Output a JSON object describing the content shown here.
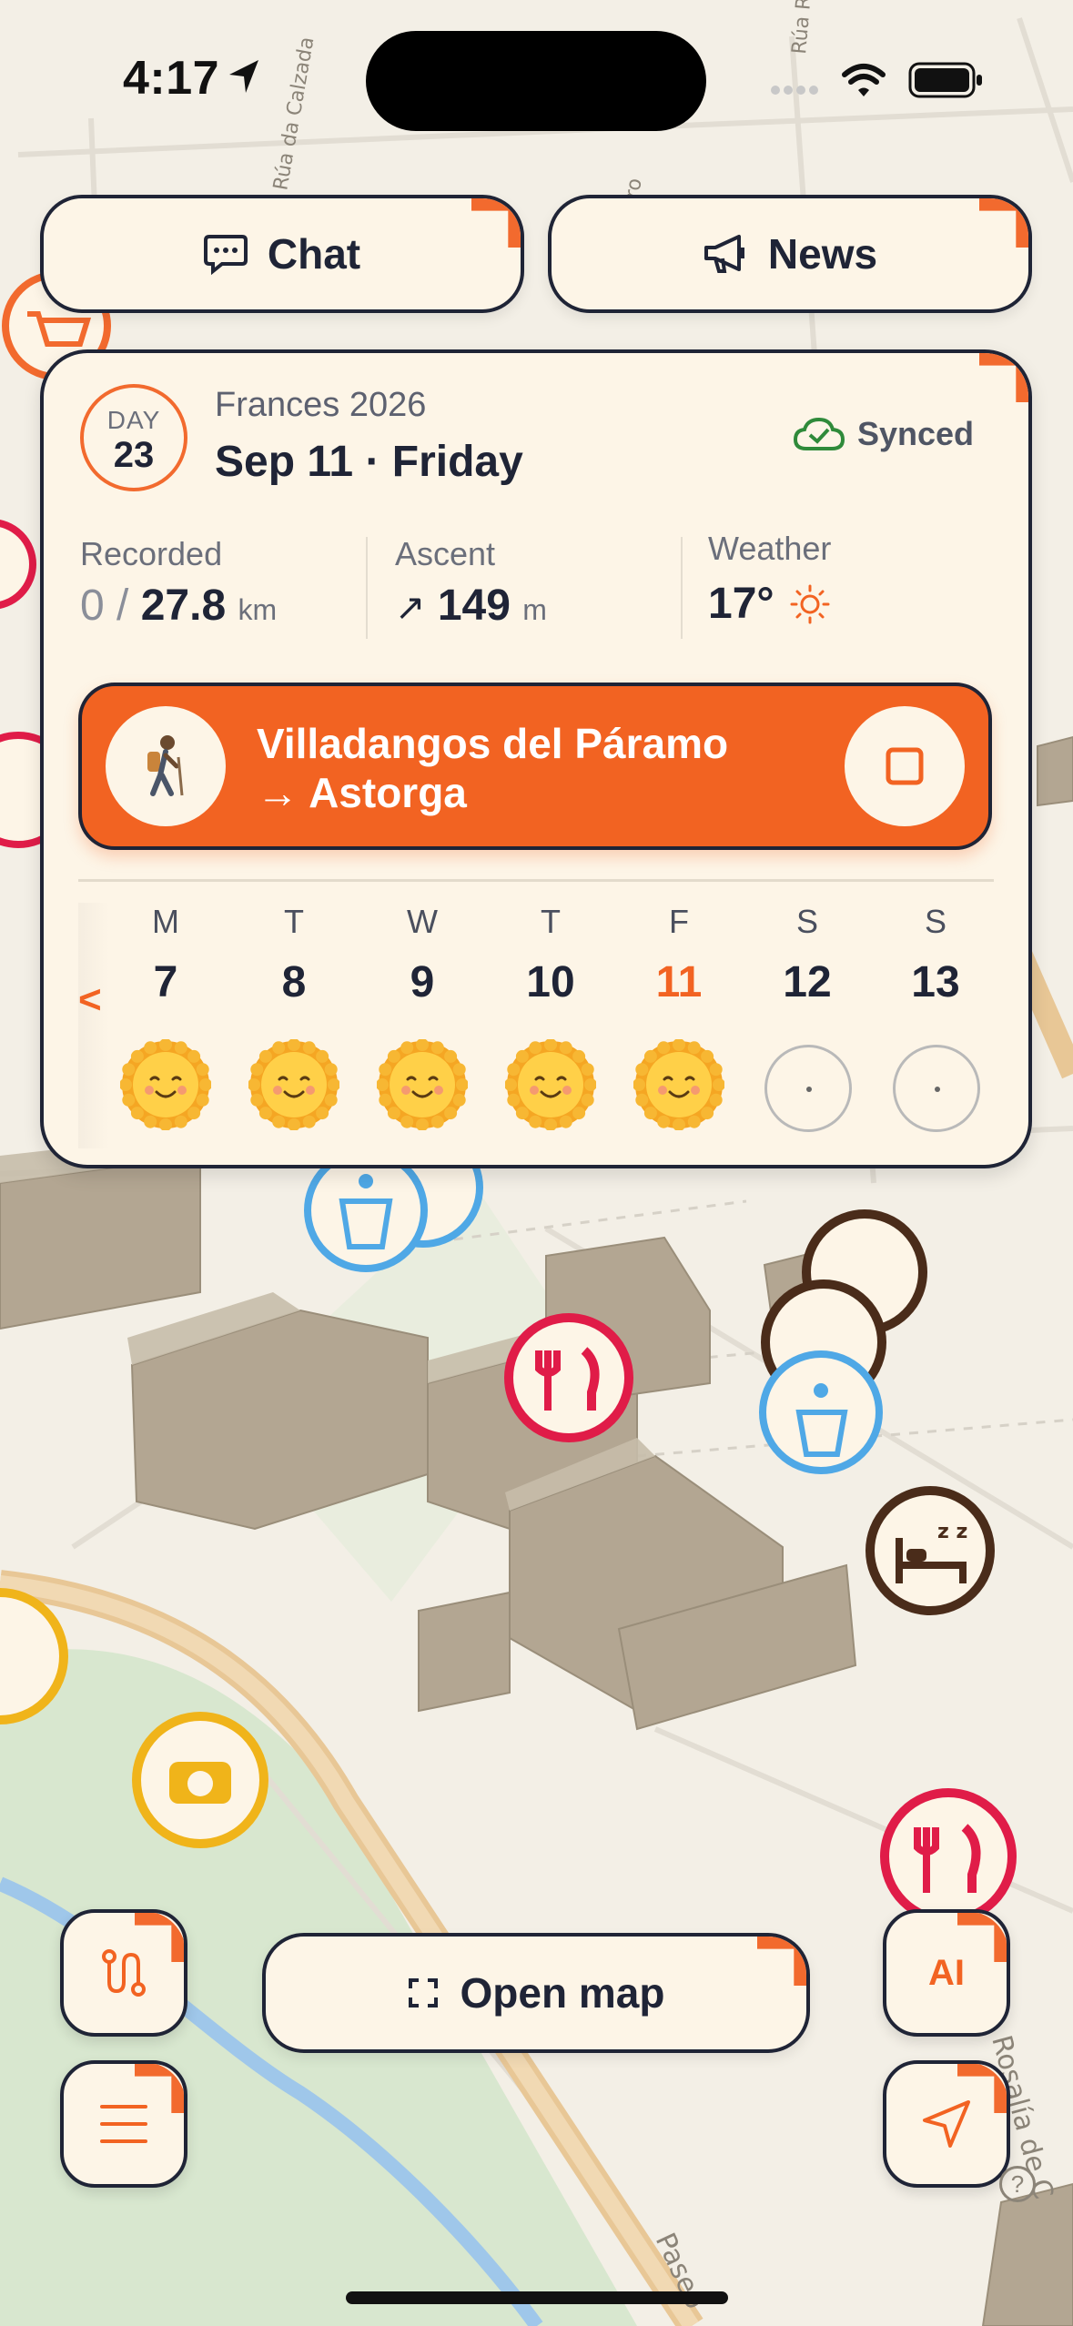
{
  "status_bar": {
    "time": "4:17"
  },
  "map": {
    "street_labels": [
      "Rúa da Calzada",
      "Rúa Río Fe",
      "iro",
      "Rosalía de C",
      "Paseo"
    ],
    "colors": {
      "land": "#f3efe6",
      "park": "#d8e7cf",
      "road": "#e8c796",
      "river": "#9fc7ea"
    }
  },
  "top_buttons": {
    "chat_label": "Chat",
    "news_label": "News"
  },
  "card": {
    "day_label": "DAY",
    "day_number": "23",
    "trip_name": "Frances 2026",
    "date": "Sep 11 · Friday",
    "sync_status": "Synced",
    "stats": {
      "recorded_label": "Recorded",
      "recorded_current": "0 /",
      "recorded_total": "27.8",
      "recorded_unit": "km",
      "ascent_label": "Ascent",
      "ascent_arrow": "↗",
      "ascent_value": "149",
      "ascent_unit": "m",
      "weather_label": "Weather",
      "weather_value": "17°"
    },
    "route": {
      "line1": "Villadangos del Páramo",
      "line2": "→ Astorga"
    },
    "week_prev": "<",
    "week": [
      {
        "letter": "M",
        "num": "7",
        "done": true
      },
      {
        "letter": "T",
        "num": "8",
        "done": true
      },
      {
        "letter": "W",
        "num": "9",
        "done": true
      },
      {
        "letter": "T",
        "num": "10",
        "done": true
      },
      {
        "letter": "F",
        "num": "11",
        "done": true,
        "today": true
      },
      {
        "letter": "S",
        "num": "12",
        "done": false
      },
      {
        "letter": "S",
        "num": "13",
        "done": false
      }
    ]
  },
  "bottom_controls": {
    "open_map_label": "Open map",
    "ai_label": "AI"
  },
  "colors": {
    "accent": "#f26322",
    "ink": "#1f2436",
    "cream": "#fdf5e7"
  }
}
